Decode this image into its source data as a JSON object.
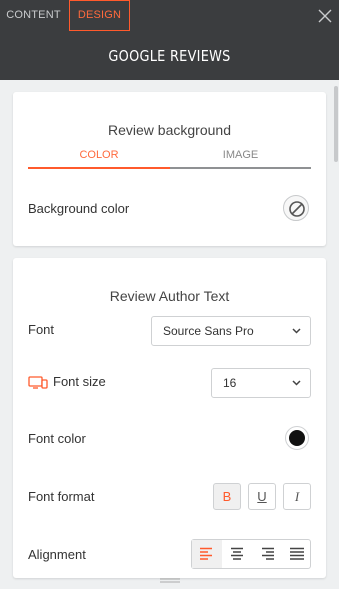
{
  "tabs": {
    "content": "CONTENT",
    "design": "DESIGN"
  },
  "header": {
    "title": "GOOGLE REVIEWS"
  },
  "background_section": {
    "title": "Review background",
    "subtabs": {
      "color": "COLOR",
      "image": "IMAGE"
    },
    "background_color_label": "Background color"
  },
  "author_section": {
    "title": "Review Author Text",
    "font_label": "Font",
    "font_value": "Source Sans Pro",
    "font_size_label": "Font size",
    "font_size_value": "16",
    "font_color_label": "Font color",
    "font_color_value": "#111111",
    "font_format_label": "Font format",
    "format_buttons": {
      "bold": "B",
      "underline": "U",
      "italic": "I"
    },
    "alignment_label": "Alignment"
  },
  "colors": {
    "accent": "#ff5a2c",
    "topbar": "#3b3d3f"
  },
  "icons": [
    "close-icon",
    "no-color-icon",
    "chevron-down-icon",
    "device-icon",
    "align-left-icon",
    "align-center-icon",
    "align-right-icon",
    "align-justify-icon",
    "drag-handle-icon"
  ]
}
